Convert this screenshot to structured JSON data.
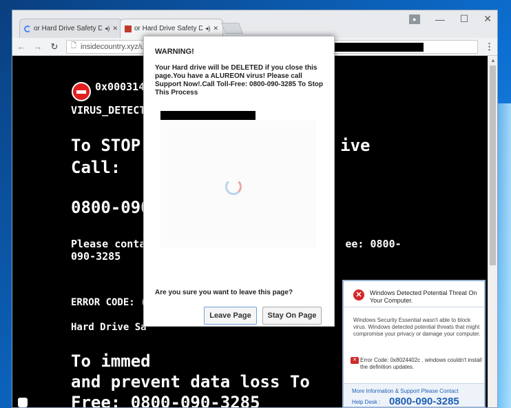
{
  "browser": {
    "tabs": [
      {
        "label": "or Hard Drive Safety D",
        "icon": "loading-spinner-icon"
      },
      {
        "label": "or Hard Drive Safety D",
        "icon": "favicon-icon"
      }
    ],
    "tab_audio": "◂)",
    "tab_close": "✕",
    "url": "insidecountry.xyz/united",
    "window_controls": {
      "minimize": "—",
      "maximize": "☐",
      "close": "✕"
    }
  },
  "scam_page": {
    "error_code": "0x000314CE",
    "virus_line": "VIRUS_DETECTED_                              G_OPERATIONS",
    "stop_line_left": "To STOP",
    "stop_line_right": "ive",
    "call_label": "Call:",
    "phone_partial": "0800-090",
    "please_left": "Please conta",
    "please_right": "ee: 0800-",
    "please_line2": "090-3285",
    "error_code_label": "ERROR CODE: (",
    "hard_drive_label": "Hard Drive Sa",
    "immediate_line1": "To immed",
    "immediate_line2": "and prevent data loss To",
    "immediate_line3": "Free: 0800-090-3285"
  },
  "dialog": {
    "title": "WARNING!",
    "message": "Your Hard drive will be DELETED if you close this page.You have a ALUREON virus! Please call Support Now!.Call Toll-Free: 0800-090-3285 To Stop This Process",
    "question": "Are you sure you want to leave this page?",
    "leave_label": "Leave Page",
    "stay_label": "Stay On Page"
  },
  "popup": {
    "title": "Windows Detected Potential Threat On Your Computer.",
    "body": "Windows Security Essential wasn't able to block virus. Windows detected potential threats that might compromise your privacy or damage your computer.",
    "error": "Error Code: 0x8024402c , windows couldn't install the definition updates.",
    "more_info": "More Information & Support Please Contact",
    "help_desk": "Help Desk :",
    "phone": "0800-090-3285"
  }
}
